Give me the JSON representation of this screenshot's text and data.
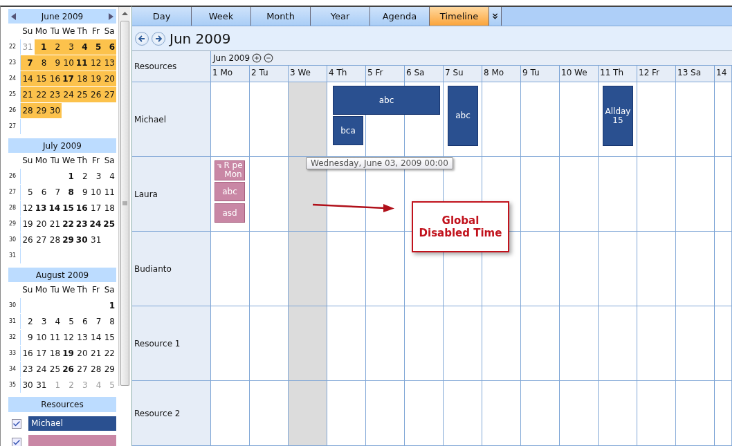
{
  "sidebar": {
    "months": [
      {
        "title": "June 2009",
        "nav": true,
        "weekdays": [
          "Su",
          "Mo",
          "Tu",
          "We",
          "Th",
          "Fr",
          "Sa"
        ],
        "weeks": [
          {
            "no": "22",
            "days": [
              {
                "d": "31",
                "bold": false,
                "muted": true,
                "selected": false
              },
              {
                "d": "1",
                "bold": true,
                "muted": false,
                "selected": true
              },
              {
                "d": "2",
                "bold": false,
                "muted": false,
                "selected": true
              },
              {
                "d": "3",
                "bold": false,
                "muted": false,
                "selected": true
              },
              {
                "d": "4",
                "bold": true,
                "muted": false,
                "selected": true
              },
              {
                "d": "5",
                "bold": true,
                "muted": false,
                "selected": true
              },
              {
                "d": "6",
                "bold": true,
                "muted": false,
                "selected": true
              }
            ]
          },
          {
            "no": "23",
            "days": [
              {
                "d": "7",
                "bold": true,
                "muted": false,
                "selected": true
              },
              {
                "d": "8",
                "bold": false,
                "muted": false,
                "selected": true
              },
              {
                "d": "9",
                "bold": false,
                "muted": false,
                "selected": true
              },
              {
                "d": "10",
                "bold": false,
                "muted": false,
                "selected": true
              },
              {
                "d": "11",
                "bold": true,
                "muted": false,
                "selected": true
              },
              {
                "d": "12",
                "bold": false,
                "muted": false,
                "selected": true
              },
              {
                "d": "13",
                "bold": false,
                "muted": false,
                "selected": true
              }
            ]
          },
          {
            "no": "24",
            "days": [
              {
                "d": "14",
                "bold": false,
                "muted": false,
                "selected": true
              },
              {
                "d": "15",
                "bold": false,
                "muted": false,
                "selected": true
              },
              {
                "d": "16",
                "bold": false,
                "muted": false,
                "selected": true
              },
              {
                "d": "17",
                "bold": true,
                "muted": false,
                "selected": true
              },
              {
                "d": "18",
                "bold": false,
                "muted": false,
                "selected": true
              },
              {
                "d": "19",
                "bold": false,
                "muted": false,
                "selected": true
              },
              {
                "d": "20",
                "bold": false,
                "muted": false,
                "selected": true
              }
            ]
          },
          {
            "no": "25",
            "days": [
              {
                "d": "21",
                "bold": false,
                "muted": false,
                "selected": true
              },
              {
                "d": "22",
                "bold": false,
                "muted": false,
                "selected": true
              },
              {
                "d": "23",
                "bold": false,
                "muted": false,
                "selected": true
              },
              {
                "d": "24",
                "bold": false,
                "muted": false,
                "selected": true
              },
              {
                "d": "25",
                "bold": false,
                "muted": false,
                "selected": true
              },
              {
                "d": "26",
                "bold": false,
                "muted": false,
                "selected": true
              },
              {
                "d": "27",
                "bold": false,
                "muted": false,
                "selected": true
              }
            ]
          },
          {
            "no": "26",
            "days": [
              {
                "d": "28",
                "bold": false,
                "muted": false,
                "selected": true
              },
              {
                "d": "29",
                "bold": false,
                "muted": false,
                "selected": true
              },
              {
                "d": "30",
                "bold": false,
                "muted": false,
                "selected": true
              }
            ]
          },
          {
            "no": "27"
          }
        ]
      },
      {
        "title": "July 2009",
        "nav": false,
        "weekdays": [
          "Su",
          "Mo",
          "Tu",
          "We",
          "Th",
          "Fr",
          "Sa"
        ],
        "weeks": [
          {
            "no": "26",
            "days": [
              {
                "d": "1",
                "bold": true,
                "muted": false,
                "selected": false
              },
              {
                "d": "2",
                "bold": false,
                "muted": false,
                "selected": false
              },
              {
                "d": "3",
                "bold": false,
                "muted": false,
                "selected": false
              },
              {
                "d": "4",
                "bold": false,
                "muted": false,
                "selected": false
              }
            ]
          },
          {
            "no": "27",
            "days": [
              {
                "d": "5",
                "bold": false,
                "muted": false,
                "selected": false
              },
              {
                "d": "6",
                "bold": false,
                "muted": false,
                "selected": false
              },
              {
                "d": "7",
                "bold": false,
                "muted": false,
                "selected": false
              },
              {
                "d": "8",
                "bold": true,
                "muted": false,
                "selected": false
              },
              {
                "d": "9",
                "bold": false,
                "muted": false,
                "selected": false
              },
              {
                "d": "10",
                "bold": false,
                "muted": false,
                "selected": false
              },
              {
                "d": "11",
                "bold": false,
                "muted": false,
                "selected": false
              }
            ]
          },
          {
            "no": "28",
            "days": [
              {
                "d": "12",
                "bold": false,
                "muted": false,
                "selected": false
              },
              {
                "d": "13",
                "bold": true,
                "muted": false,
                "selected": false
              },
              {
                "d": "14",
                "bold": true,
                "muted": false,
                "selected": false
              },
              {
                "d": "15",
                "bold": true,
                "muted": false,
                "selected": false
              },
              {
                "d": "16",
                "bold": true,
                "muted": false,
                "selected": false
              },
              {
                "d": "17",
                "bold": false,
                "muted": false,
                "selected": false
              },
              {
                "d": "18",
                "bold": false,
                "muted": false,
                "selected": false
              }
            ]
          },
          {
            "no": "29",
            "days": [
              {
                "d": "19",
                "bold": false,
                "muted": false,
                "selected": false
              },
              {
                "d": "20",
                "bold": false,
                "muted": false,
                "selected": false
              },
              {
                "d": "21",
                "bold": false,
                "muted": false,
                "selected": false
              },
              {
                "d": "22",
                "bold": true,
                "muted": false,
                "selected": false
              },
              {
                "d": "23",
                "bold": true,
                "muted": false,
                "selected": false
              },
              {
                "d": "24",
                "bold": true,
                "muted": false,
                "selected": false
              },
              {
                "d": "25",
                "bold": true,
                "muted": false,
                "selected": false
              }
            ]
          },
          {
            "no": "30",
            "days": [
              {
                "d": "26",
                "bold": false,
                "muted": false,
                "selected": false
              },
              {
                "d": "27",
                "bold": false,
                "muted": false,
                "selected": false
              },
              {
                "d": "28",
                "bold": false,
                "muted": false,
                "selected": false
              },
              {
                "d": "29",
                "bold": true,
                "muted": false,
                "selected": false
              },
              {
                "d": "30",
                "bold": true,
                "muted": false,
                "selected": false
              },
              {
                "d": "31",
                "bold": false,
                "muted": false,
                "selected": false
              }
            ]
          },
          {
            "no": "31"
          }
        ]
      },
      {
        "title": "August 2009",
        "nav": false,
        "weekdays": [
          "Su",
          "Mo",
          "Tu",
          "We",
          "Th",
          "Fr",
          "Sa"
        ],
        "weeks": [
          {
            "no": "30",
            "days": [
              {
                "d": "1",
                "bold": true,
                "muted": false,
                "selected": false
              }
            ]
          },
          {
            "no": "31",
            "days": [
              {
                "d": "2",
                "bold": false,
                "muted": false,
                "selected": false
              },
              {
                "d": "3",
                "bold": false,
                "muted": false,
                "selected": false
              },
              {
                "d": "4",
                "bold": false,
                "muted": false,
                "selected": false
              },
              {
                "d": "5",
                "bold": false,
                "muted": false,
                "selected": false
              },
              {
                "d": "6",
                "bold": false,
                "muted": false,
                "selected": false
              },
              {
                "d": "7",
                "bold": false,
                "muted": false,
                "selected": false
              },
              {
                "d": "8",
                "bold": false,
                "muted": false,
                "selected": false
              }
            ]
          },
          {
            "no": "32",
            "days": [
              {
                "d": "9",
                "bold": false,
                "muted": false,
                "selected": false
              },
              {
                "d": "10",
                "bold": false,
                "muted": false,
                "selected": false
              },
              {
                "d": "11",
                "bold": false,
                "muted": false,
                "selected": false
              },
              {
                "d": "12",
                "bold": false,
                "muted": false,
                "selected": false
              },
              {
                "d": "13",
                "bold": false,
                "muted": false,
                "selected": false
              },
              {
                "d": "14",
                "bold": false,
                "muted": false,
                "selected": false
              },
              {
                "d": "15",
                "bold": false,
                "muted": false,
                "selected": false
              }
            ]
          },
          {
            "no": "33",
            "days": [
              {
                "d": "16",
                "bold": false,
                "muted": false,
                "selected": false
              },
              {
                "d": "17",
                "bold": false,
                "muted": false,
                "selected": false
              },
              {
                "d": "18",
                "bold": false,
                "muted": false,
                "selected": false
              },
              {
                "d": "19",
                "bold": true,
                "muted": false,
                "selected": false
              },
              {
                "d": "20",
                "bold": false,
                "muted": false,
                "selected": false
              },
              {
                "d": "21",
                "bold": false,
                "muted": false,
                "selected": false
              },
              {
                "d": "22",
                "bold": false,
                "muted": false,
                "selected": false
              }
            ]
          },
          {
            "no": "34",
            "days": [
              {
                "d": "23",
                "bold": false,
                "muted": false,
                "selected": false
              },
              {
                "d": "24",
                "bold": false,
                "muted": false,
                "selected": false
              },
              {
                "d": "25",
                "bold": false,
                "muted": false,
                "selected": false
              },
              {
                "d": "26",
                "bold": true,
                "muted": false,
                "selected": false
              },
              {
                "d": "27",
                "bold": false,
                "muted": false,
                "selected": false
              },
              {
                "d": "28",
                "bold": false,
                "muted": false,
                "selected": false
              },
              {
                "d": "29",
                "bold": false,
                "muted": false,
                "selected": false
              }
            ]
          },
          {
            "no": "35",
            "days": [
              {
                "d": "30",
                "bold": false,
                "muted": false,
                "selected": false
              },
              {
                "d": "31",
                "bold": false,
                "muted": false,
                "selected": false
              },
              {
                "d": "1",
                "bold": false,
                "muted": true,
                "selected": false
              },
              {
                "d": "2",
                "bold": false,
                "muted": true,
                "selected": false
              },
              {
                "d": "3",
                "bold": false,
                "muted": true,
                "selected": false
              },
              {
                "d": "4",
                "bold": false,
                "muted": true,
                "selected": false
              },
              {
                "d": "5",
                "bold": false,
                "muted": true,
                "selected": false
              }
            ]
          }
        ]
      }
    ],
    "resources_title": "Resources",
    "resources": [
      {
        "name": "Michael",
        "checked": true,
        "color": "#2a5090"
      },
      {
        "checked": true,
        "color": "#c987a5"
      }
    ]
  },
  "tabs": [
    {
      "label": "Day",
      "selected": false
    },
    {
      "label": "Week",
      "selected": false
    },
    {
      "label": "Month",
      "selected": false
    },
    {
      "label": "Year",
      "selected": false
    },
    {
      "label": "Agenda",
      "selected": false
    },
    {
      "label": "Timeline",
      "selected": true
    }
  ],
  "period_title": "Jun 2009",
  "timeline": {
    "resources_header": "Resources",
    "month_label": "Jun 2009",
    "days": [
      {
        "label": "1 Mo",
        "disabled": false
      },
      {
        "label": "2 Tu",
        "disabled": false
      },
      {
        "label": "3 We",
        "disabled": true
      },
      {
        "label": "4 Th",
        "disabled": false
      },
      {
        "label": "5 Fr",
        "disabled": false
      },
      {
        "label": "6 Sa",
        "disabled": false
      },
      {
        "label": "7 Su",
        "disabled": false
      },
      {
        "label": "8 Mo",
        "disabled": false
      },
      {
        "label": "9 Tu",
        "disabled": false
      },
      {
        "label": "10 We",
        "disabled": false
      },
      {
        "label": "11 Th",
        "disabled": false
      },
      {
        "label": "12 Fr",
        "disabled": false
      },
      {
        "label": "13 Sa",
        "disabled": false
      },
      {
        "label": "14",
        "disabled": false
      }
    ],
    "resources": [
      {
        "name": "Michael"
      },
      {
        "name": "Laura"
      },
      {
        "name": "Budianto"
      },
      {
        "name": "Resource 1"
      },
      {
        "name": "Resource 2"
      }
    ],
    "events": [
      {
        "title": "abc",
        "color": "#2a5090",
        "recurring": false
      },
      {
        "title": "bca",
        "color": "#2a5090",
        "recurring": false
      },
      {
        "title": "abc",
        "color": "#2a5090",
        "recurring": false
      },
      {
        "title": "Allday\n15",
        "color": "#2a5090",
        "recurring": false
      },
      {
        "title": "R pe\nMon",
        "color": "#c987a5",
        "recurring": true
      },
      {
        "title": "abc",
        "color": "#c987a5",
        "recurring": false
      },
      {
        "title": "asd",
        "color": "#c987a5",
        "recurring": false
      }
    ],
    "tooltip": "Wednesday, June 03, 2009 00:00",
    "callout": "Global\nDisabled Time"
  }
}
